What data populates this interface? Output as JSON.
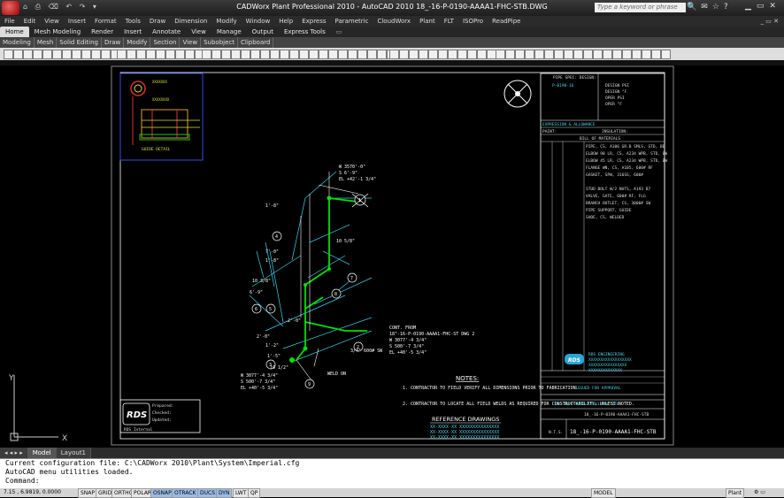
{
  "window": {
    "title": "CADWorx Plant Professional 2010 - AutoCAD 2010   18_-16-P-0190-AAAA1-FHC-STB.DWG",
    "search_placeholder": "Type a keyword or phrase",
    "qat": "⌂ ⎙ ⌫ ↶ ↷ ▾"
  },
  "menu": [
    "File",
    "Edit",
    "View",
    "Insert",
    "Format",
    "Tools",
    "Draw",
    "Dimension",
    "Modify",
    "Window",
    "Help",
    "Express",
    "Parametric",
    "CloudWorx",
    "Plant",
    "FLT",
    "ISOPro",
    "ReadPipe"
  ],
  "ribbon_tabs": [
    "Home",
    "Mesh Modeling",
    "Render",
    "Insert",
    "Annotate",
    "View",
    "Manage",
    "Output",
    "Express Tools"
  ],
  "ribbon_active": "Home",
  "panels": [
    "Modeling",
    "Mesh",
    "Solid Editing",
    "Draw",
    "Modify",
    "Section",
    "View",
    "Subobject",
    "Clipboard"
  ],
  "drawing": {
    "dims": [
      "W 3570'-0\"",
      "S 6'-9\"",
      "EL +42'-1 3/4\"",
      "1'-8\"",
      "10 5/8\"",
      "7'-0\"",
      "1'-8\"",
      "10 3/8\"",
      "6'-9\"",
      "2'-0\"",
      "1'-2\"",
      "2'-0\"",
      "1'-5\"",
      "10 1/2\"",
      "W 3077'-4 3/4\"",
      "S 500'-7 3/4\"",
      "EL +40'-5 3/4\"",
      "WELD ON"
    ],
    "cont_note": [
      "CONT. FROM",
      "18\"-16-P-0190-AAAA1-FHC-ST DWG 2",
      "W 3077'-4 3/4\"",
      "S 500'-7 3/4\"",
      "EL +40'-5 3/4\""
    ],
    "fitting_label": "3/4\" 600# SW",
    "notes_title": "NOTES:",
    "notes": [
      "1. CONTRACTOR TO FIELD VERIFY ALL DIMENSIONS PRIOR TO FABRICATION.",
      "2. CONTRACTOR TO LOCATE ALL FIELD WELDS AS REQUIRED FOR CONSTRUCTABILITY, UNLESS NOTED."
    ],
    "ref_title": "REFERENCE DRAWINGS",
    "refs": [
      "XX-XXXX-XX    XXXXXXXXXXXXXXX",
      "XX-XXXX-XX    XXXXXXXXXXXXXXX",
      "XX-XXXX-XX    XXXXXXXXXXXXXXX"
    ],
    "detail_label": "GUIDE DETAIL",
    "logo": "RDS",
    "prepared_rows": [
      "Prepared:",
      "Checked:",
      "Updated:"
    ],
    "prepared_right": "RDS Internal"
  },
  "title_block": {
    "line_no": "18\"-16-P-0190-AAAA1-FHC-STB",
    "dwg_no": "18_-16-P-0190-AAAA1-FHC-STB",
    "short_no": "18_-16-P-0190-AAAA1-FHC-STB",
    "bom_title": "BILL OF MATERIALS",
    "pipe_header": "PIPE SPEC: DESIGN:",
    "pipe_spec": "P-0190-16",
    "pressure_label": "EXPRESSION & ALLOWANCE",
    "paint_label": "PAINT:",
    "insulation_label": "INSULATION:",
    "design_rows": [
      "DESIGN  PSI",
      "DESIGN  °F",
      "OPER   PSI",
      "OPER   °F"
    ],
    "bom_items": [
      "PIPE, CS, A106 GR.B SMLS, STD, BE",
      "ELBOW 90 LR, CS, A234 WPB, STD, BW",
      "ELBOW 45 LR, CS, A234 WPB, STD, BW",
      "FLANGE WN, CS, A105, 600# RF",
      "GASKET, SPW, 316SS, 600#",
      "STUD BOLT W/2 NUTS, A193 B7",
      "VALVE, GATE, 600# RF, FLG",
      "BRANCH OUTLET, CS, 3000# SW",
      "PIPE SUPPORT, GUIDE",
      "SHOE, CS, WELDED"
    ],
    "revision_line": "ISSUED FOR APPROVAL",
    "company": [
      "RDS ENGINEERING",
      "XXXXXXXXXXXXXXXXXX",
      "XXXXXXXXXXXXXXXX",
      "XXXXXXXXXXXXXX"
    ],
    "scale": "N.T.S."
  },
  "layout_tabs": [
    "Model",
    "Layout1"
  ],
  "layout_active": "Model",
  "command": {
    "lines": [
      "Current configuration file: C:\\CADWorx 2010\\Plant\\System\\Imperial.cfg",
      "AutoCAD menu utilities loaded."
    ],
    "prompt": "Command:"
  },
  "status": {
    "coords": "7.15 , 6.9819, 0.0000",
    "toggles": [
      "SNAP",
      "GRID",
      "ORTHO",
      "POLAR",
      "OSNAP",
      "OTRACK",
      "DUCS",
      "DYN",
      "LWT",
      "QP"
    ],
    "active_toggles": [
      "OSNAP",
      "OTRACK",
      "DUCS",
      "DYN"
    ],
    "model": "MODEL",
    "workspace": "Plant"
  },
  "colors": {
    "pipe": "#00e000",
    "dim": "#3ad0e6",
    "text": "#ffffff",
    "border": "#9a9a9a"
  }
}
